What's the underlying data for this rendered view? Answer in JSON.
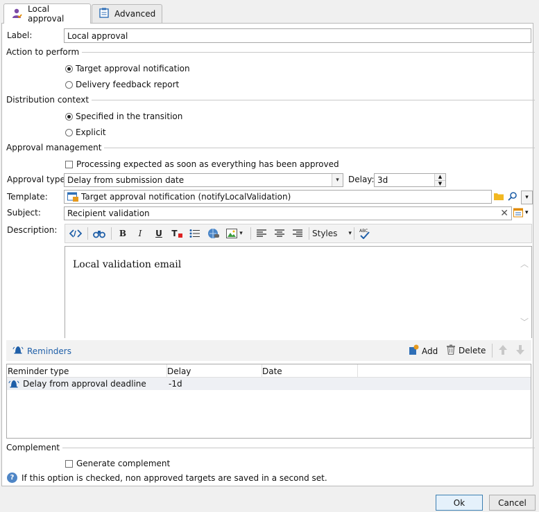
{
  "tabs": [
    {
      "label": "Local approval",
      "icon": "user-approval-icon",
      "active": true
    },
    {
      "label": "Advanced",
      "icon": "clipboard-icon",
      "active": false
    }
  ],
  "label_field": {
    "label": "Label:",
    "value": "Local approval"
  },
  "action": {
    "title": "Action to perform",
    "options": [
      "Target approval notification",
      "Delivery feedback report"
    ],
    "selected": 0
  },
  "distribution": {
    "title": "Distribution context",
    "options": [
      "Specified in the transition",
      "Explicit"
    ],
    "selected": 0
  },
  "approval": {
    "title": "Approval management",
    "checkbox_label": "Processing expected as soon as everything has been approved",
    "type_label": "Approval type:",
    "type_value": "Delay from submission date",
    "delay_label": "Delay:",
    "delay_value": "3d"
  },
  "template": {
    "label": "Template:",
    "value": "Target approval notification (notifyLocalValidation)"
  },
  "subject": {
    "label": "Subject:",
    "value": "Recipient validation"
  },
  "description": {
    "label": "Description:",
    "toolbar": {
      "styles_label": "Styles"
    },
    "content": "Local validation email"
  },
  "reminders": {
    "title": "Reminders",
    "add_label": "Add",
    "delete_label": "Delete",
    "columns": [
      "Reminder type",
      "Delay",
      "Date"
    ],
    "rows": [
      {
        "type": "Delay from approval deadline",
        "delay": "-1d",
        "date": ""
      }
    ]
  },
  "complement": {
    "title": "Complement",
    "checkbox_label": "Generate complement",
    "help_text": "If this option is checked, non approved targets are saved in a second set."
  },
  "buttons": {
    "ok": "Ok",
    "cancel": "Cancel"
  },
  "colors": {
    "accent": "#1f5fa8",
    "selected_row": "#eef0f4"
  }
}
